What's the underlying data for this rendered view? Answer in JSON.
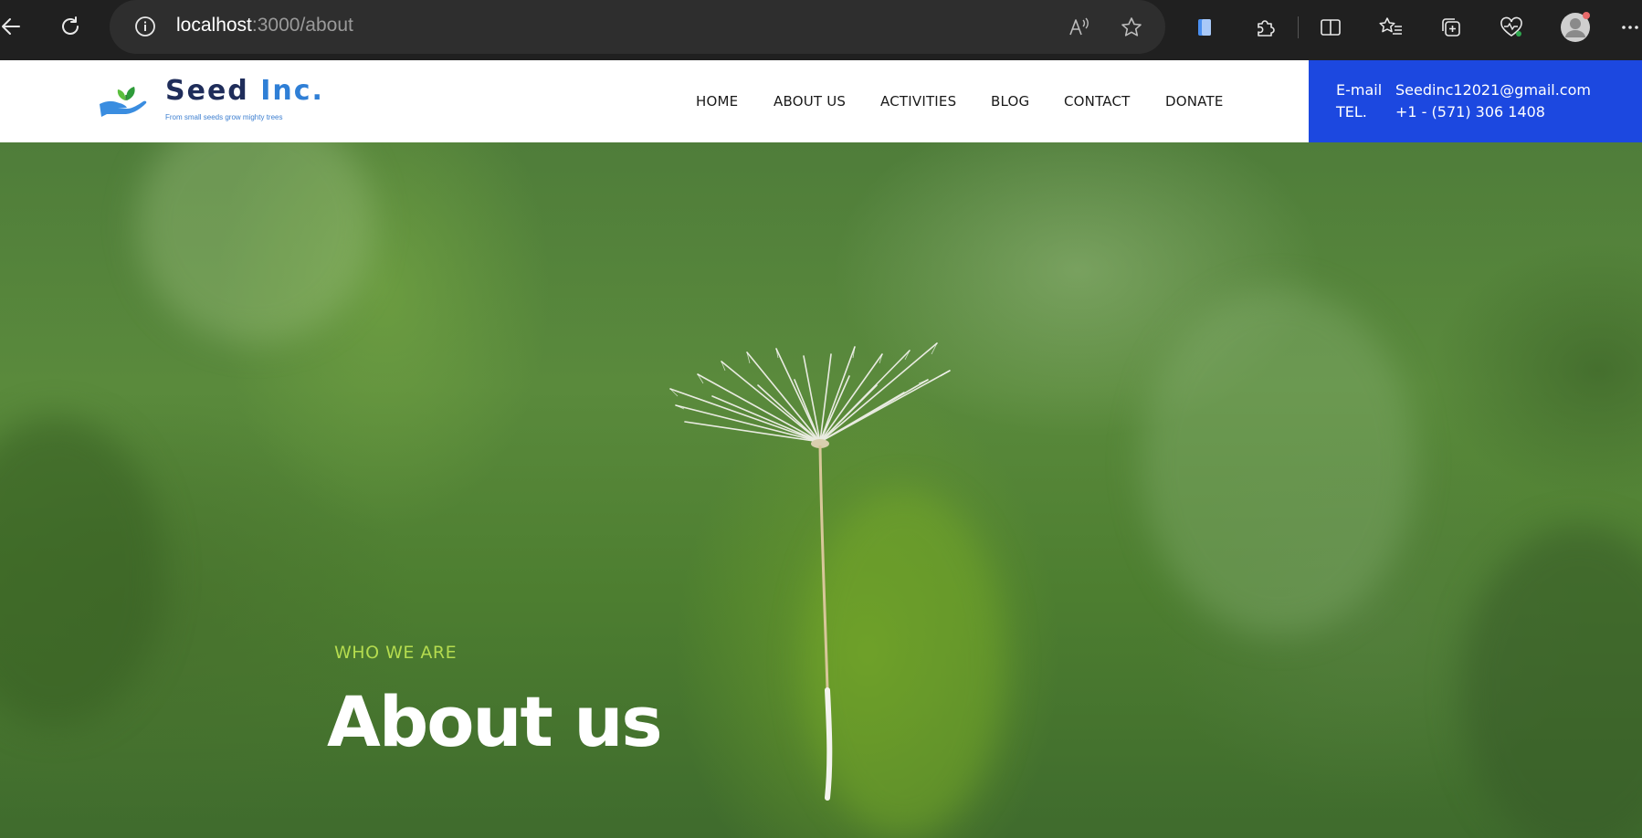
{
  "browser": {
    "url_host": "localhost",
    "url_path": ":3000/about",
    "icons": [
      "back-arrow-icon",
      "refresh-icon",
      "site-info-icon",
      "read-aloud-icon",
      "favorite-star-icon",
      "sidebar-app-icon",
      "extensions-icon",
      "split-screen-icon",
      "favorites-list-icon",
      "collections-icon",
      "browser-essentials-icon",
      "profile-avatar-icon",
      "more-options-icon"
    ]
  },
  "site": {
    "logo": {
      "brand": "Seed",
      "brand_suffix": "Inc.",
      "tagline": "From small seeds grow mighty trees"
    },
    "nav": [
      {
        "label": "HOME"
      },
      {
        "label": "ABOUT US"
      },
      {
        "label": "ACTIVITIES"
      },
      {
        "label": "BLOG"
      },
      {
        "label": "CONTACT"
      },
      {
        "label": "DONATE"
      }
    ],
    "contact": {
      "email_label": "E-mail",
      "email_value": "Seedinc12021@gmail.com",
      "tel_label": "TEL.",
      "tel_value": "+1 - (571) 306 1408"
    }
  },
  "hero": {
    "eyebrow": "WHO WE ARE",
    "title": "About us"
  },
  "colors": {
    "chrome_bg": "#202020",
    "address_bar": "#2e2e2e",
    "contact_box": "#1c48e0",
    "eyebrow": "#b5dc4f",
    "brand_dark": "#1f2d5a",
    "brand_blue": "#2f7fd6"
  }
}
